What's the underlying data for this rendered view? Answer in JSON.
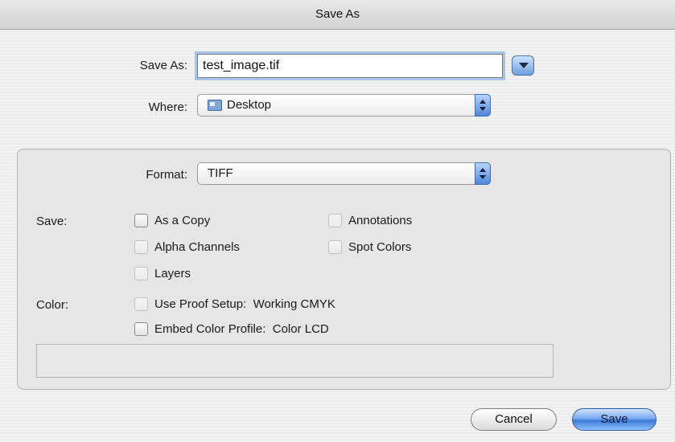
{
  "window": {
    "title": "Save As"
  },
  "save_as": {
    "label": "Save As:",
    "value": "test_image.tif"
  },
  "where": {
    "label": "Where:",
    "value": "Desktop",
    "icon": "folder-icon"
  },
  "format": {
    "label": "Format:",
    "value": "TIFF"
  },
  "save_options": {
    "label": "Save:",
    "as_copy": {
      "label": "As a Copy",
      "checked": false,
      "enabled": true
    },
    "alpha_channels": {
      "label": "Alpha Channels",
      "checked": false,
      "enabled": false
    },
    "layers": {
      "label": "Layers",
      "checked": false,
      "enabled": false
    },
    "annotations": {
      "label": "Annotations",
      "checked": false,
      "enabled": false
    },
    "spot_colors": {
      "label": "Spot Colors",
      "checked": false,
      "enabled": false
    }
  },
  "color_options": {
    "label": "Color:",
    "use_proof_setup": {
      "label": "Use Proof Setup:",
      "profile": "Working CMYK",
      "checked": false,
      "enabled": false
    },
    "embed_color_profile": {
      "label": "Embed Color Profile:",
      "profile": "Color LCD",
      "checked": false,
      "enabled": true
    }
  },
  "buttons": {
    "cancel": "Cancel",
    "save": "Save"
  },
  "colors": {
    "accent": "#4f86d8",
    "focus_ring": "#a6c4ea"
  }
}
